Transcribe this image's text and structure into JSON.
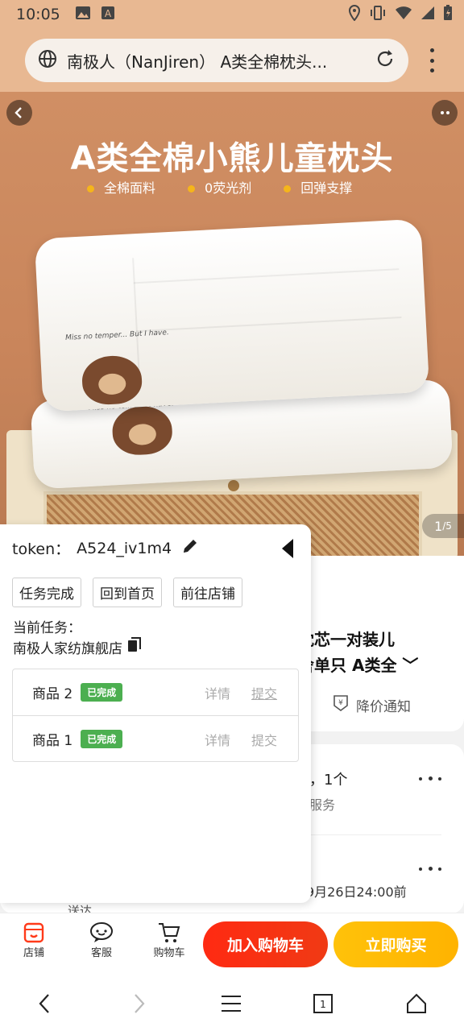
{
  "status_bar": {
    "time": "10:05"
  },
  "browser": {
    "url_text": "南极人（NanJiren） A类全棉枕头..."
  },
  "hero": {
    "title": "A类全棉小熊儿童枕头",
    "features": [
      "全棉面料",
      "0荧光剂",
      "回弹支撑"
    ],
    "pillow_text_1": "Miss no temper... But I have.",
    "pillow_text_2": "Miss no te... But I have.",
    "page_current": "1",
    "page_total": "/5"
  },
  "product": {
    "title_line1": "枕芯一对装儿",
    "title_line2": "舍单只 A类全",
    "price_notice": "降价通知"
  },
  "services": {
    "line1": "，1个",
    "line2": "服务",
    "line3": "9月26日24:00前",
    "line4": "送达"
  },
  "panel": {
    "token_label": "token：",
    "token_value": "A524_iv1m4",
    "buttons": [
      "任务完成",
      "回到首页",
      "前往店铺"
    ],
    "current_task_label": "当前任务：",
    "current_task_value": "南极人家纺旗舰店",
    "tasks": [
      {
        "name": "商品 2",
        "status": "已完成",
        "detail": "详情",
        "submit": "提交"
      },
      {
        "name": "商品 1",
        "status": "已完成",
        "detail": "详情",
        "submit": "提交"
      }
    ]
  },
  "action_bar": {
    "store": "店铺",
    "service": "客服",
    "cart": "购物车",
    "add_cart": "加入购物车",
    "buy_now": "立即购买"
  },
  "nav": {
    "tabs_count": "1"
  },
  "colors": {
    "accent_red": "#ff2a12",
    "accent_yellow": "#ffc20a",
    "done_green": "#4caf50"
  }
}
